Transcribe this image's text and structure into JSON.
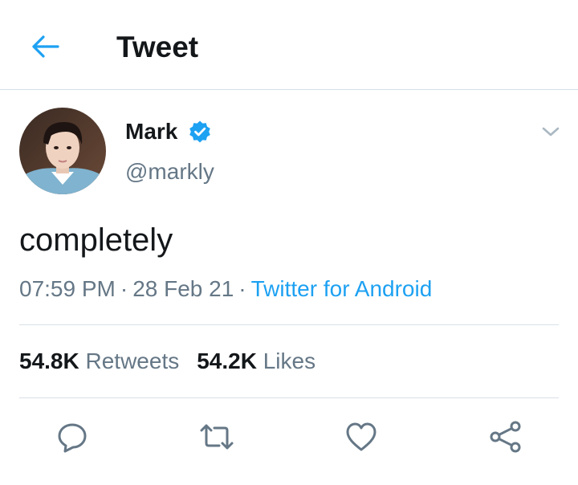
{
  "header": {
    "title": "Tweet",
    "back_icon": "arrow-left-icon"
  },
  "author": {
    "name": "Mark",
    "handle": "@markly",
    "verified": true,
    "verified_color": "#1da1f2",
    "menu_icon": "chevron-down-icon"
  },
  "tweet": {
    "text": "completely",
    "time": "07:59 PM",
    "separator": "·",
    "date": "28 Feb 21",
    "source": "Twitter for Android"
  },
  "stats": {
    "retweets_count": "54.8K",
    "retweets_label": "Retweets",
    "likes_count": "54.2K",
    "likes_label": "Likes"
  },
  "actions": [
    {
      "name": "reply",
      "icon": "reply-icon"
    },
    {
      "name": "retweet",
      "icon": "retweet-icon"
    },
    {
      "name": "like",
      "icon": "heart-icon"
    },
    {
      "name": "share",
      "icon": "share-icon"
    }
  ],
  "colors": {
    "accent": "#1da1f2",
    "text_primary": "#14171a",
    "text_secondary": "#657786",
    "divider": "#d8e0e6"
  }
}
